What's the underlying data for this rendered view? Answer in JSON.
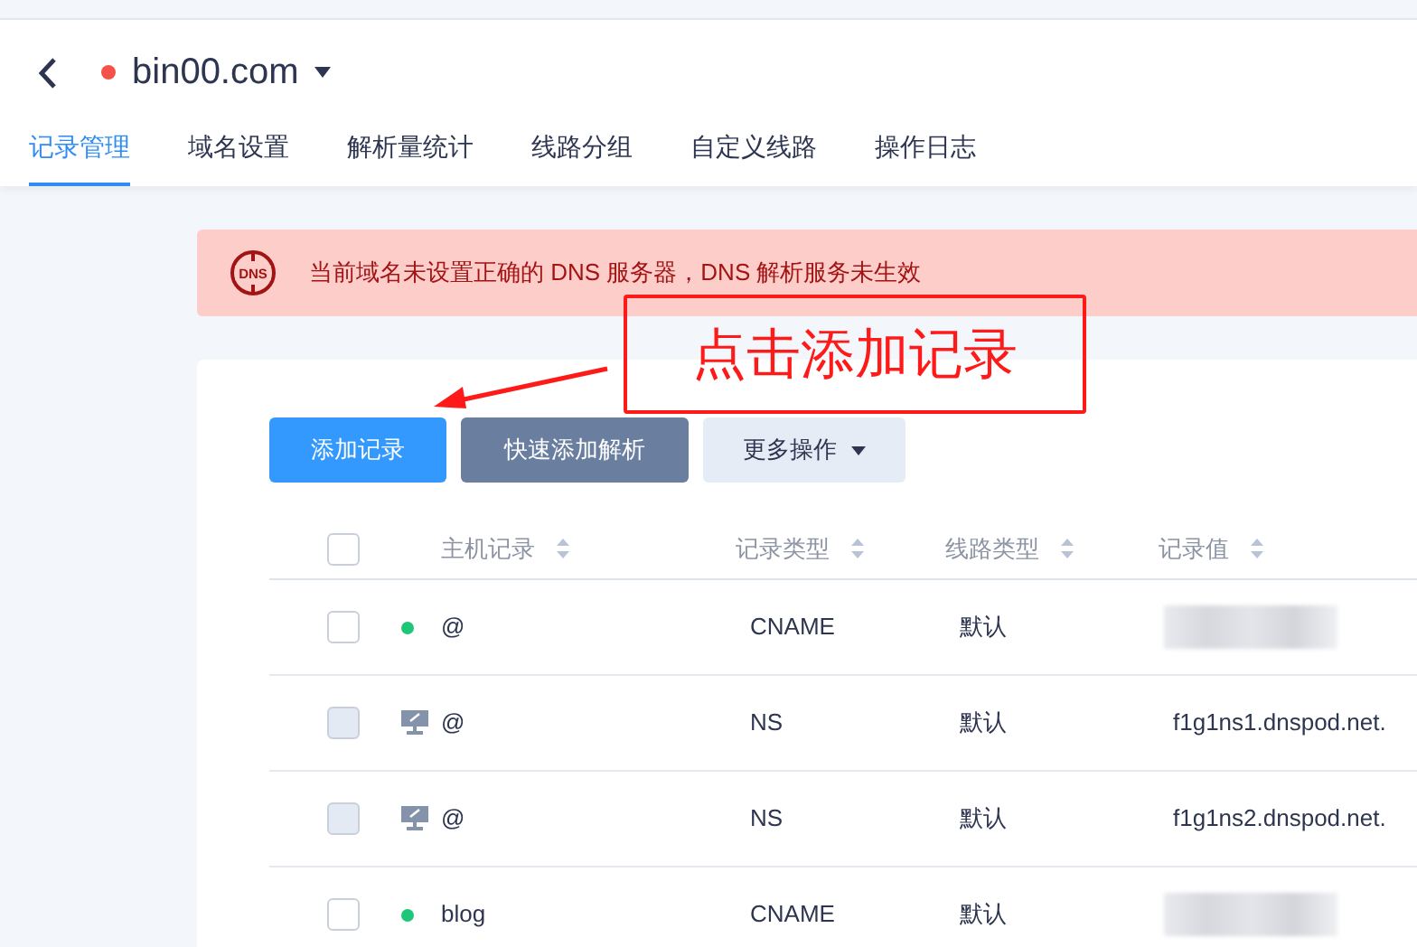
{
  "header": {
    "domain": "bin00.com"
  },
  "tabs": [
    {
      "label": "记录管理",
      "selected": true
    },
    {
      "label": "域名设置",
      "selected": false
    },
    {
      "label": "解析量统计",
      "selected": false
    },
    {
      "label": "线路分组",
      "selected": false
    },
    {
      "label": "自定义线路",
      "selected": false
    },
    {
      "label": "操作日志",
      "selected": false
    }
  ],
  "alert": {
    "icon_label": "DNS",
    "text": "当前域名未设置正确的 DNS 服务器，DNS 解析服务未生效"
  },
  "annotation": {
    "text": "点击添加记录"
  },
  "toolbar": {
    "add": "添加记录",
    "quick_add": "快速添加解析",
    "more": "更多操作"
  },
  "table": {
    "all_checked": false,
    "columns": [
      "主机记录",
      "记录类型",
      "线路类型",
      "记录值"
    ],
    "rows": [
      {
        "kind": "status",
        "color": "#1ec677",
        "disabled": false,
        "host": "@",
        "type": "CNAME",
        "line": "默认",
        "value_blurred": true
      },
      {
        "kind": "system",
        "disabled": true,
        "host": "@",
        "type": "NS",
        "line": "默认",
        "value": "f1g1ns1.dnspod.net.",
        "value_blurred": false
      },
      {
        "kind": "system",
        "disabled": true,
        "host": "@",
        "type": "NS",
        "line": "默认",
        "value": "f1g1ns2.dnspod.net.",
        "value_blurred": false
      },
      {
        "kind": "status",
        "color": "#1ec677",
        "disabled": false,
        "host": "blog",
        "type": "CNAME",
        "line": "默认",
        "value_blurred": true
      }
    ]
  }
}
